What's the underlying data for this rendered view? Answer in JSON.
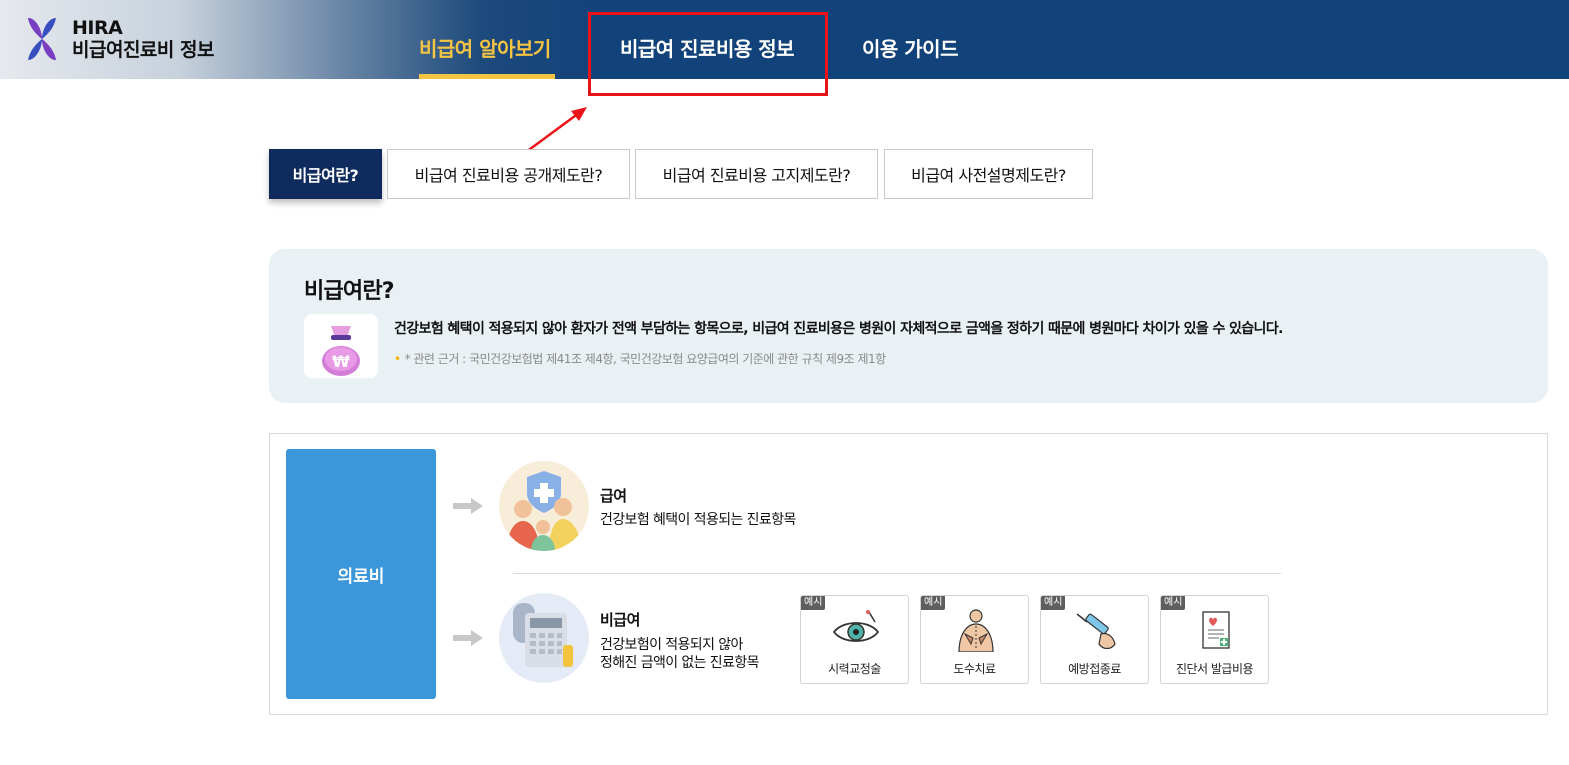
{
  "header": {
    "brand_line1": "HIRA",
    "brand_line2": "비급여진료비 정보",
    "nav": [
      {
        "label": "비급여 알아보기",
        "active": true
      },
      {
        "label": "비급여 진료비용 정보",
        "active": false
      },
      {
        "label": "이용 가이드",
        "active": false
      }
    ]
  },
  "tabs": [
    {
      "label": "비급여란?",
      "active": true
    },
    {
      "label": "비급여 진료비용 공개제도란?",
      "active": false
    },
    {
      "label": "비급여 진료비용 고지제도란?",
      "active": false
    },
    {
      "label": "비급여 사전설명제도란?",
      "active": false
    }
  ],
  "info": {
    "title": "비급여란?",
    "description": "건강보험 혜택이 적용되지 않아 환자가 전액 부담하는 항목으로, 비급여 진료비용은 병원이 자체적으로 금액을 정하기 때문에 병원마다 차이가 있을 수 있습니다.",
    "note": "* 관련 근거 : 국민건강보험법 제41조 제4항, 국민건강보험 요양급여의 기준에 관한 규칙 제9조 제1항"
  },
  "diagram": {
    "root_label": "의료비",
    "covered": {
      "title": "급여",
      "description": "건강보험 혜택이 적용되는 진료항목"
    },
    "noncovered": {
      "title": "비급여",
      "description_line1": "건강보험이 적용되지 않아",
      "description_line2": "정해진 금액이 없는 진료항목"
    },
    "examples": [
      {
        "badge": "예시",
        "label": "시력교정술",
        "icon": "eye-icon"
      },
      {
        "badge": "예시",
        "label": "도수치료",
        "icon": "manual-therapy-icon"
      },
      {
        "badge": "예시",
        "label": "예방접종료",
        "icon": "syringe-icon"
      },
      {
        "badge": "예시",
        "label": "진단서 발급비용",
        "icon": "certificate-icon"
      }
    ]
  },
  "colors": {
    "header_navy": "#12427a",
    "active_nav": "#f5c443",
    "tab_active": "#0f2b5e",
    "root_blue": "#3b97d9",
    "highlight_red": "#e8141a"
  }
}
